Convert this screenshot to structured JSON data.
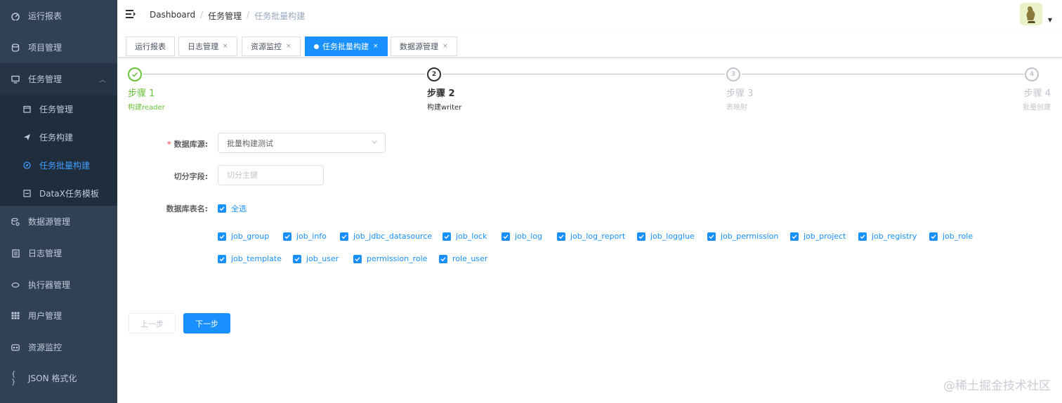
{
  "sidebar": {
    "items": [
      {
        "label": "运行报表"
      },
      {
        "label": "项目管理"
      },
      {
        "label": "任务管理"
      },
      {
        "label": "数据源管理"
      },
      {
        "label": "日志管理"
      },
      {
        "label": "执行器管理"
      },
      {
        "label": "用户管理"
      },
      {
        "label": "资源监控"
      },
      {
        "label": "JSON 格式化"
      }
    ],
    "submenu": [
      {
        "label": "任务管理"
      },
      {
        "label": "任务构建"
      },
      {
        "label": "任务批量构建"
      },
      {
        "label": "DataX任务模板"
      }
    ]
  },
  "navbar": {
    "breadcrumb": [
      "Dashboard",
      "任务管理",
      "任务批量构建"
    ]
  },
  "tags": [
    {
      "label": "运行报表"
    },
    {
      "label": "日志管理"
    },
    {
      "label": "资源监控"
    },
    {
      "label": "任务批量构建"
    },
    {
      "label": "数据源管理"
    }
  ],
  "steps": [
    {
      "title": "步骤 1",
      "desc": "构建reader",
      "icon": "check",
      "status": "success"
    },
    {
      "title": "步骤 2",
      "desc": "构建writer",
      "icon": "2",
      "status": "process"
    },
    {
      "title": "步骤 3",
      "desc": "表映射",
      "icon": "3",
      "status": "wait"
    },
    {
      "title": "步骤 4",
      "desc": "批量创建",
      "icon": "4",
      "status": "wait"
    }
  ],
  "form": {
    "datasource_label": "数据库源:",
    "datasource_value": "批量构建测试",
    "split_label": "切分字段:",
    "split_placeholder": "切分主键",
    "tables_label": "数据库表名:",
    "select_all": "全选",
    "tables": [
      "job_group",
      "job_info",
      "job_jdbc_datasource",
      "job_lock",
      "job_log",
      "job_log_report",
      "job_logglue",
      "job_permission",
      "job_project",
      "job_registry",
      "job_role",
      "job_template",
      "job_user",
      "permission_role",
      "role_user"
    ]
  },
  "buttons": {
    "prev": "上一步",
    "next": "下一步"
  },
  "watermark": "@稀土掘金技术社区",
  "colors": {
    "sidebar_bg": "#304156",
    "primary": "#1890ff",
    "success": "#67c23a"
  }
}
